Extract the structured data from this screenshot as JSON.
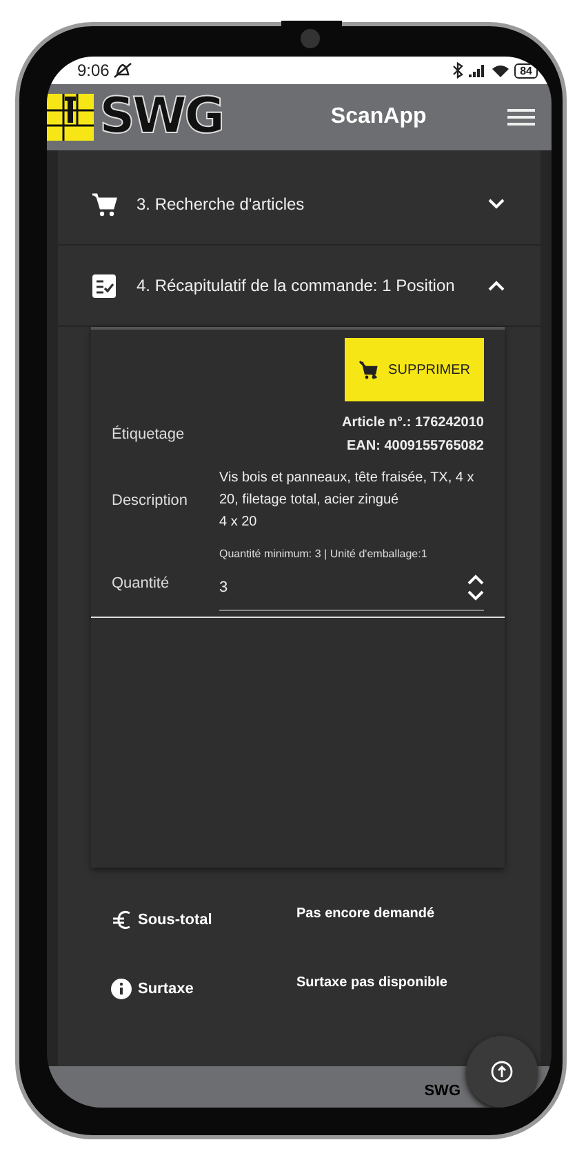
{
  "status_bar": {
    "time": "9:06",
    "battery": "84"
  },
  "header": {
    "logo": "SWG",
    "title": "ScanApp"
  },
  "sections": [
    {
      "kind": "cart",
      "title": "3. Recherche d'articles",
      "expanded": false
    },
    {
      "kind": "checklist",
      "title": "4. Récapitulatif de la commande: 1 Position",
      "expanded": true
    }
  ],
  "item": {
    "delete_button": "SUPPRIMER",
    "fields": [
      {
        "kind": "labeling",
        "label": "Étiquetage",
        "lines": [
          "Article n°.: 176242010",
          "EAN: 4009155765082"
        ]
      },
      {
        "kind": "description",
        "label": "Description",
        "lines": [
          "Vis bois et panneaux, tête fraisée, TX, 4 x 20, filetage total, acier zingué",
          "4 x 20"
        ]
      }
    ],
    "quantity": {
      "label": "Quantité",
      "hint": "Quantité minimum: 3 | Unité d'emballage:1",
      "value": "3"
    }
  },
  "totals": [
    {
      "kind": "euro",
      "label": "Sous-total",
      "value": "Pas encore demandé"
    },
    {
      "kind": "info",
      "label": "Surtaxe",
      "value": "Surtaxe pas disponible"
    }
  ],
  "footer": {
    "brand": "SWG"
  }
}
